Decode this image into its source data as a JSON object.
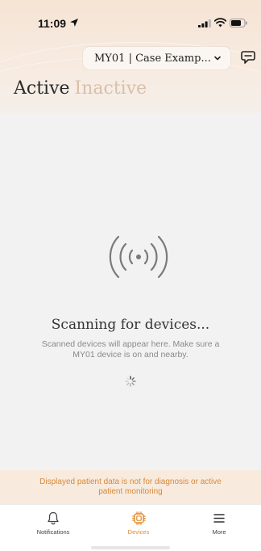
{
  "status_bar": {
    "time": "11:09"
  },
  "header": {
    "case_selector": "MY01 | Case Examp...",
    "tabs": [
      {
        "label": "Active",
        "selected": true
      },
      {
        "label": "Inactive",
        "selected": false
      }
    ]
  },
  "main": {
    "title": "Scanning for devices...",
    "subtitle": "Scanned devices will appear here. Make sure a MY01 device is on and nearby."
  },
  "disclaimer": "Displayed patient data is not for diagnosis or active patient monitoring",
  "bottom_nav": {
    "items": [
      {
        "label": "Notifications",
        "icon": "bell-icon",
        "active": false
      },
      {
        "label": "Devices",
        "icon": "device-chip-icon",
        "active": true
      },
      {
        "label": "More",
        "icon": "menu-icon",
        "active": false
      }
    ]
  },
  "colors": {
    "accent": "#e08a2e",
    "disclaimer_bg": "#f8eadc",
    "inactive_tab": "#d9bfa9"
  }
}
